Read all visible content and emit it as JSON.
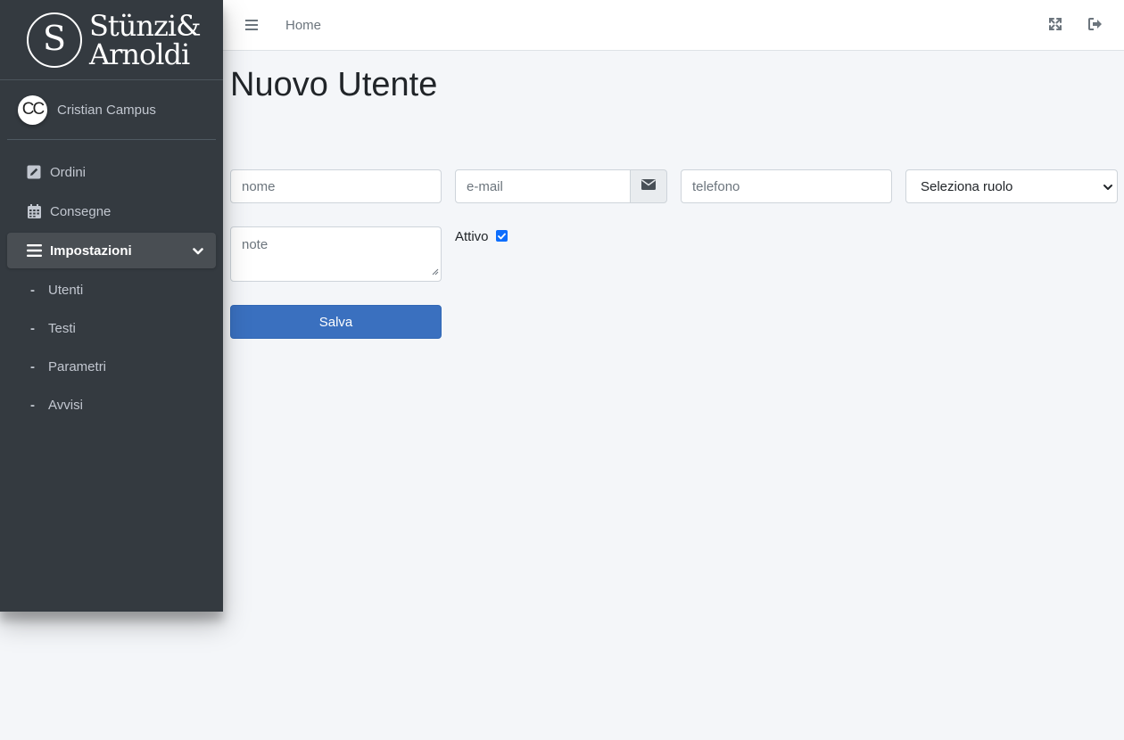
{
  "brand": {
    "line1": "Stünzi&",
    "line2": "Arnoldi",
    "mark": "S"
  },
  "user": {
    "initials": "CC",
    "name": "Cristian Campus"
  },
  "sidebar": {
    "items": [
      {
        "label": "Ordini",
        "icon": "edit-icon"
      },
      {
        "label": "Consegne",
        "icon": "calendar-icon"
      },
      {
        "label": "Impostazioni",
        "icon": "bars-icon",
        "active": true
      }
    ],
    "sub_items": [
      {
        "label": "Utenti"
      },
      {
        "label": "Testi"
      },
      {
        "label": "Parametri"
      },
      {
        "label": "Avvisi"
      }
    ],
    "sub_dash": "-"
  },
  "topbar": {
    "home_label": "Home"
  },
  "page": {
    "title": "Nuovo Utente"
  },
  "form": {
    "name_placeholder": "nome",
    "email_placeholder": "e-mail",
    "phone_placeholder": "telefono",
    "role_select": "Seleziona ruolo",
    "note_placeholder": "note",
    "active_label": "Attivo",
    "active_checked": true,
    "save_label": "Salva"
  },
  "colors": {
    "sidebar_bg": "#343a40",
    "primary": "#3a70bf",
    "page_bg": "#f4f6f9"
  }
}
